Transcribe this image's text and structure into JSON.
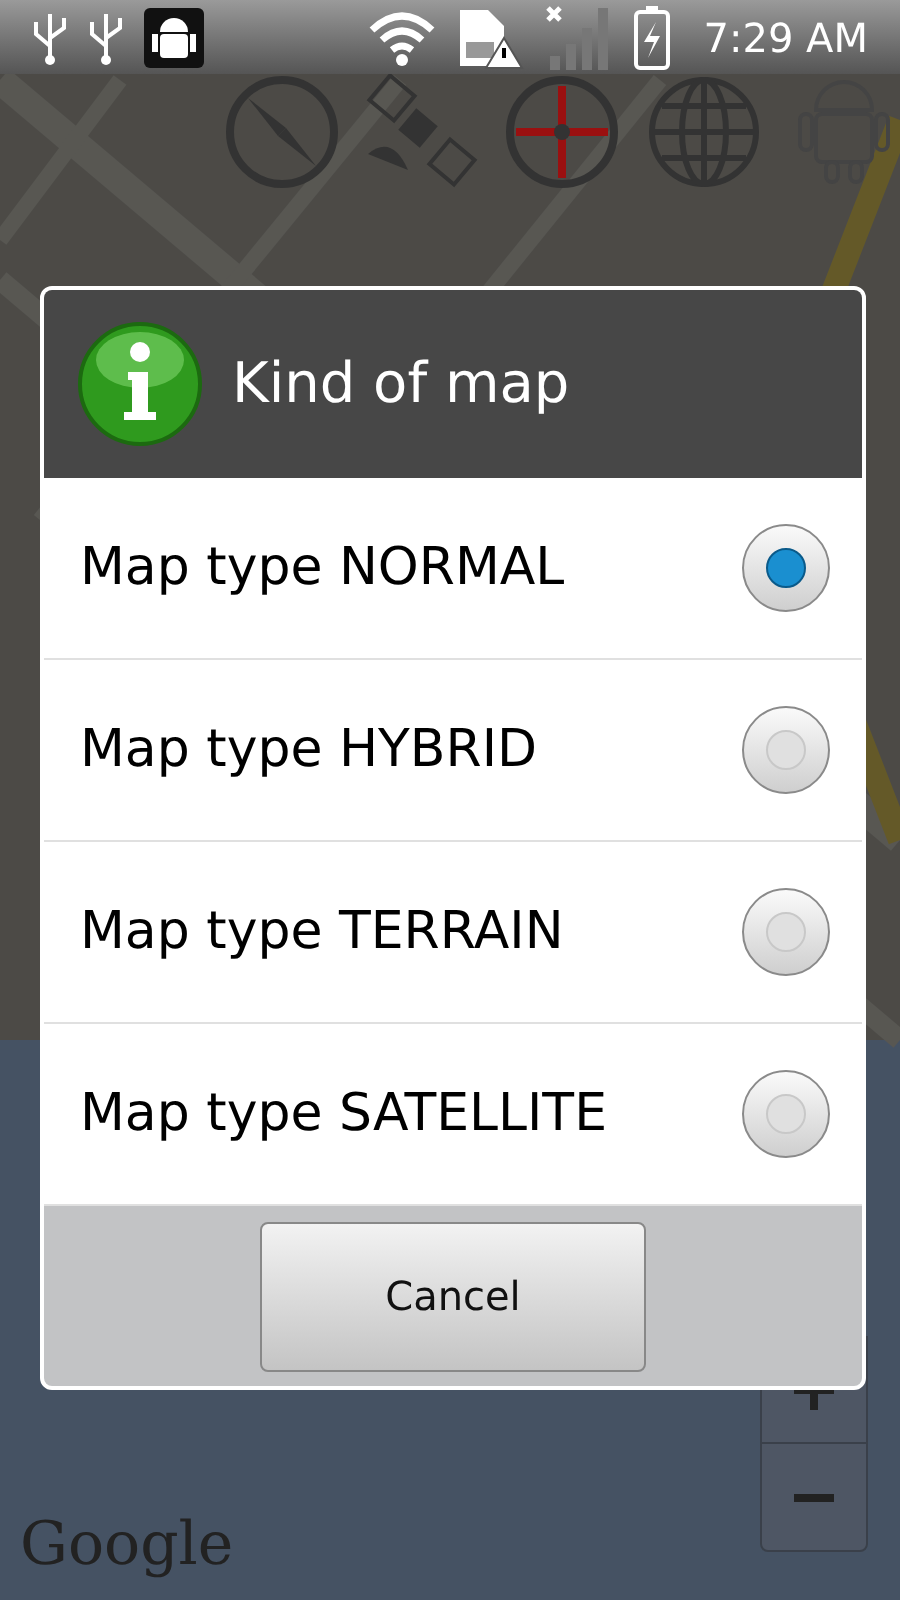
{
  "status_bar": {
    "time": "7:29 AM"
  },
  "map": {
    "attribution": "Google"
  },
  "dialog": {
    "title": "Kind of map",
    "options": [
      {
        "label": "Map type NORMAL",
        "selected": true
      },
      {
        "label": "Map type HYBRID",
        "selected": false
      },
      {
        "label": "Map type TERRAIN",
        "selected": false
      },
      {
        "label": "Map type SATELLITE",
        "selected": false
      }
    ],
    "buttons": [
      "Cancel"
    ]
  }
}
